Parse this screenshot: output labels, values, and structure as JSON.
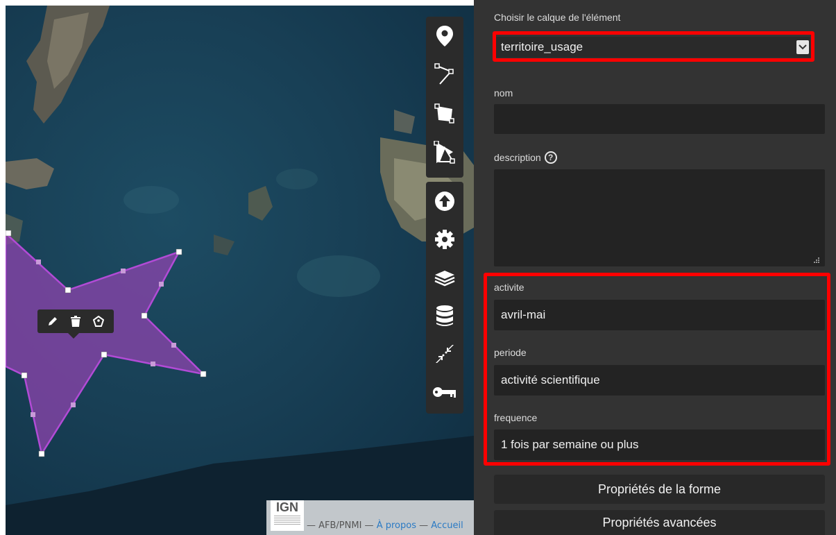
{
  "map": {
    "attribution": {
      "logo_text": "IGN",
      "source": "— AFB/PNMI —",
      "about_link": "À propos",
      "separator": "—",
      "home_link": "Accueil"
    },
    "draw_toolbar": [
      "marker-icon",
      "polyline-icon",
      "polygon-icon",
      "edit-vertices-icon"
    ],
    "tools_toolbar": [
      "upload-icon",
      "gear-icon",
      "layers-icon",
      "database-icon",
      "collapse-icon",
      "key-icon"
    ],
    "popup_actions": [
      "pencil-icon",
      "trash-icon",
      "tag-icon"
    ]
  },
  "panel": {
    "layer_label": "Choisir le calque de l'élément",
    "layer_selected": "territoire_usage",
    "nom_label": "nom",
    "nom_value": "",
    "description_label": "description",
    "description_help": "?",
    "description_value": "",
    "activite_label": "activite",
    "activite_value": "avril-mai",
    "periode_label": "periode",
    "periode_value": "activité scientifique",
    "frequence_label": "frequence",
    "frequence_value": "1 fois par semaine ou plus",
    "shape_props_button": "Propriétés de la forme",
    "advanced_props_button": "Propriétés avancées"
  },
  "colors": {
    "highlight": "#ff0000",
    "polygon_fill": "#8e44ad",
    "panel_bg": "#333333"
  }
}
